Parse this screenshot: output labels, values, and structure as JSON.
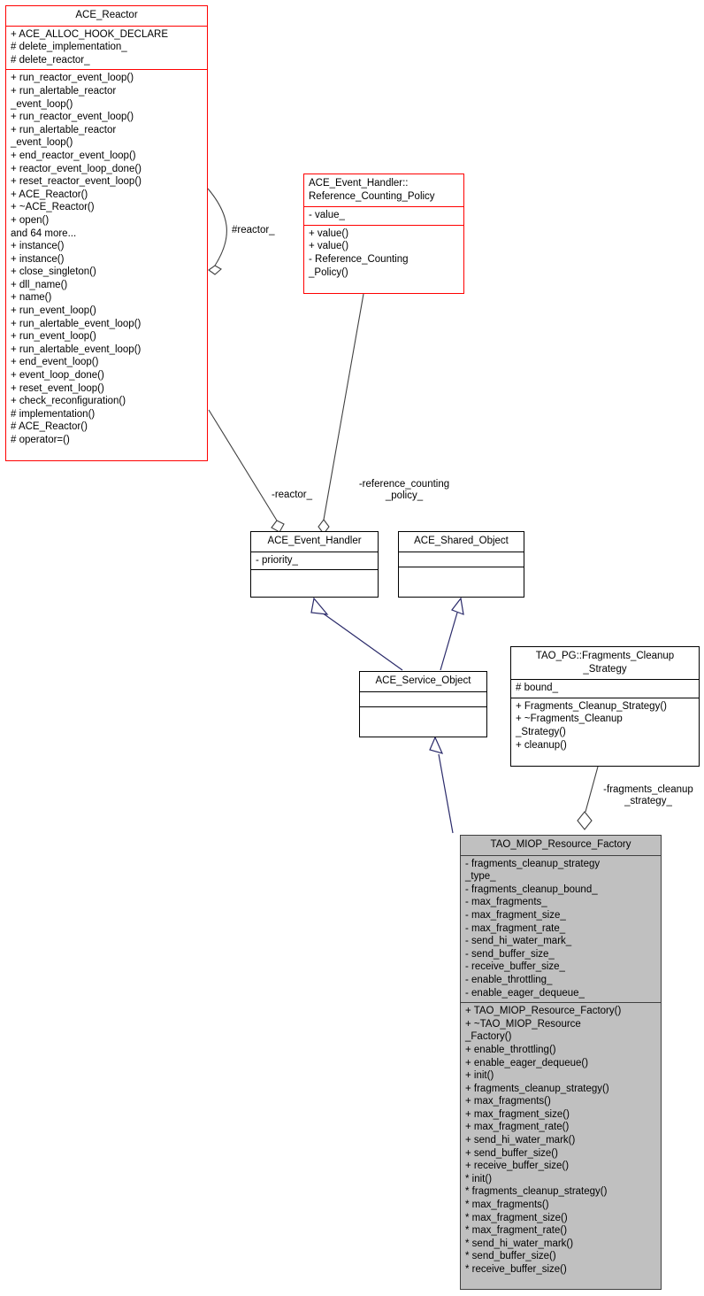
{
  "diagram": {
    "kind": "uml-class-diagram",
    "colors": {
      "highlight_border": "#ff0000",
      "focus_fill": "#c0c0c0",
      "normal_border": "#000000",
      "association_line": "#404040",
      "inheritance_line": "#2a2a6a",
      "background": "#ffffff"
    }
  },
  "nodes": {
    "ace_reactor": {
      "title": "ACE_Reactor",
      "attributes": "+ ACE_ALLOC_HOOK_DECLARE\n# delete_implementation_\n# delete_reactor_",
      "operations": "+ run_reactor_event_loop()\n+ run_alertable_reactor\n_event_loop()\n+ run_reactor_event_loop()\n+ run_alertable_reactor\n_event_loop()\n+ end_reactor_event_loop()\n+ reactor_event_loop_done()\n+ reset_reactor_event_loop()\n+ ACE_Reactor()\n+ ~ACE_Reactor()\n+ open()\nand 64 more...\n+ instance()\n+ instance()\n+ close_singleton()\n+ dll_name()\n+ name()\n+ run_event_loop()\n+ run_alertable_event_loop()\n+ run_event_loop()\n+ run_alertable_event_loop()\n+ end_event_loop()\n+ event_loop_done()\n+ reset_event_loop()\n+ check_reconfiguration()\n# implementation()\n# ACE_Reactor()\n# operator=()"
    },
    "reference_counting_policy": {
      "title": "ACE_Event_Handler::\nReference_Counting_Policy",
      "attributes": "- value_",
      "operations": "+ value()\n+ value()\n- Reference_Counting\n_Policy()"
    },
    "ace_event_handler": {
      "title": "ACE_Event_Handler",
      "attributes": "- priority_",
      "operations": ""
    },
    "ace_shared_object": {
      "title": "ACE_Shared_Object",
      "attributes": "",
      "operations": ""
    },
    "ace_service_object": {
      "title": "ACE_Service_Object",
      "attributes": "",
      "operations": ""
    },
    "fragments_cleanup_strategy": {
      "title": "TAO_PG::Fragments_Cleanup\n_Strategy",
      "attributes": "# bound_",
      "operations": "+ Fragments_Cleanup_Strategy()\n+ ~Fragments_Cleanup\n_Strategy()\n+ cleanup()"
    },
    "tao_miop_resource_factory": {
      "title": "TAO_MIOP_Resource_Factory",
      "attributes": "- fragments_cleanup_strategy\n_type_\n- fragments_cleanup_bound_\n- max_fragments_\n- max_fragment_size_\n- max_fragment_rate_\n- send_hi_water_mark_\n- send_buffer_size_\n- receive_buffer_size_\n- enable_throttling_\n- enable_eager_dequeue_",
      "operations": "+ TAO_MIOP_Resource_Factory()\n+ ~TAO_MIOP_Resource\n_Factory()\n+ enable_throttling()\n+ enable_eager_dequeue()\n+ init()\n+ fragments_cleanup_strategy()\n+ max_fragments()\n+ max_fragment_size()\n+ max_fragment_rate()\n+ send_hi_water_mark()\n+ send_buffer_size()\n+ receive_buffer_size()\n* init()\n* fragments_cleanup_strategy()\n* max_fragments()\n* max_fragment_size()\n* max_fragment_rate()\n* send_hi_water_mark()\n* send_buffer_size()\n* receive_buffer_size()"
    }
  },
  "edge_labels": {
    "self_reactor": "#reactor_",
    "reactor": "-reactor_",
    "reference_counting_policy": "-reference_counting\n_policy_",
    "fragments_cleanup_strategy": "-fragments_cleanup\n_strategy_"
  }
}
